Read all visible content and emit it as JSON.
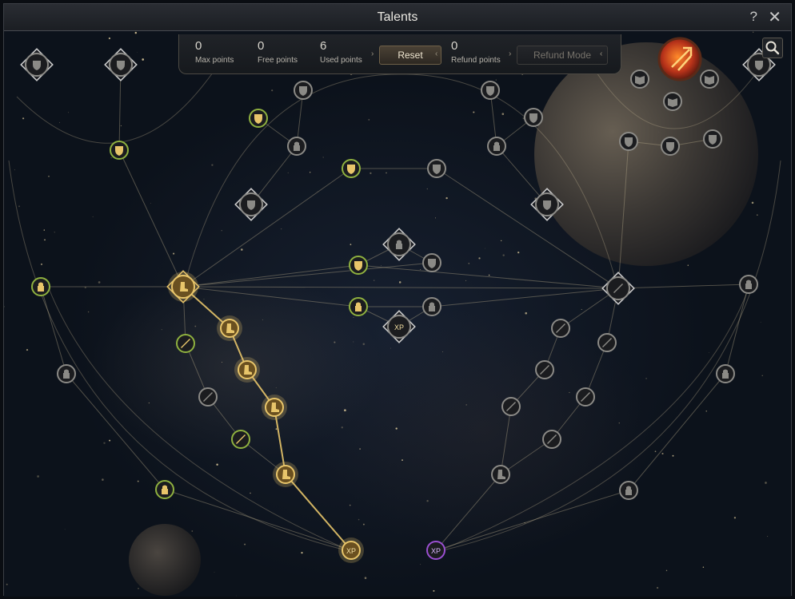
{
  "window": {
    "title": "Talents"
  },
  "stats": {
    "max_points": {
      "value": "0",
      "label": "Max points"
    },
    "free_points": {
      "value": "0",
      "label": "Free points"
    },
    "used_points": {
      "value": "6",
      "label": "Used points"
    },
    "refund_points": {
      "value": "0",
      "label": "Refund points"
    }
  },
  "buttons": {
    "reset": "Reset",
    "refund_mode": "Refund Mode",
    "help": "?",
    "close": "✕"
  },
  "icons": {
    "search": "search-icon",
    "skill_portrait": "flame-skill-icon"
  },
  "node_states": {
    "allocated": "#e8c56a",
    "available": "#8fb13f",
    "locked": "#8b8a86",
    "xp_special": "#9a4fd1"
  },
  "xp_badge": "XP"
}
